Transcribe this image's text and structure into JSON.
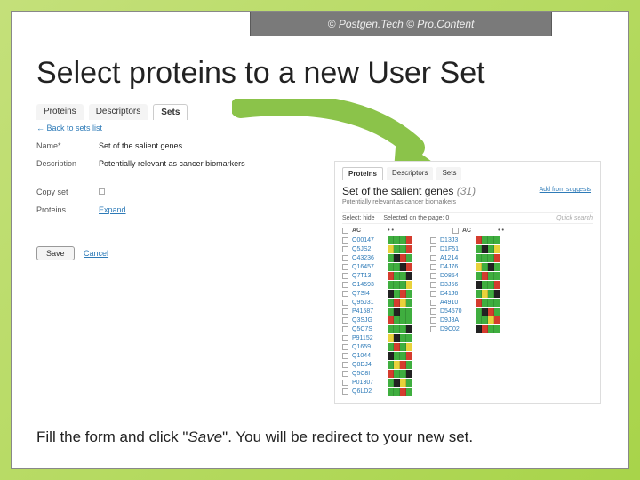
{
  "header": {
    "copyright": "© Postgen.Tech © Pro.Content"
  },
  "slide": {
    "title": "Select proteins to a new User Set"
  },
  "tabs_main": {
    "proteins": "Proteins",
    "descriptors": "Descriptors",
    "sets": "Sets"
  },
  "form": {
    "back": "← Back to sets list",
    "name_label": "Name*",
    "name_value": "Set of the salient genes",
    "desc_label": "Description",
    "desc_value": "Potentially relevant as cancer biomarkers",
    "copy_label": "Copy set",
    "proteins_label": "Proteins",
    "expand": "Expand",
    "save": "Save",
    "cancel": "Cancel"
  },
  "right": {
    "tabs": {
      "proteins": "Proteins",
      "descriptors": "Descriptors",
      "sets": "Sets"
    },
    "title": "Set of the salient genes",
    "count": "(31)",
    "subtitle": "Potentially relevant as cancer biomarkers",
    "add_link": "Add from suggests",
    "select_hide": "Select: hide",
    "selected_text": "Selected on the page: 0",
    "quick_search": "Quick search",
    "col_header": "AC",
    "col1": [
      {
        "ac": "O00147",
        "p": "gggr"
      },
      {
        "ac": "Q5JS2",
        "p": "yggr"
      },
      {
        "ac": "O43236",
        "p": "gkrg"
      },
      {
        "ac": "Q16457",
        "p": "ggkr"
      },
      {
        "ac": "Q7T13",
        "p": "rggk"
      },
      {
        "ac": "O14593",
        "p": "gggy"
      },
      {
        "ac": "Q7SI4",
        "p": "kgrg"
      },
      {
        "ac": "Q95J31",
        "p": "gryg"
      },
      {
        "ac": "P41587",
        "p": "gkgg"
      },
      {
        "ac": "Q3SJG",
        "p": "rggg"
      },
      {
        "ac": "Q5C7S",
        "p": "gggk"
      },
      {
        "ac": "P91152",
        "p": "ykgg"
      },
      {
        "ac": "Q1659",
        "p": "grgy"
      },
      {
        "ac": "Q1044",
        "p": "kggr"
      },
      {
        "ac": "Q8DJ4",
        "p": "gyrg"
      },
      {
        "ac": "Q5C8I",
        "p": "rggk"
      },
      {
        "ac": "P01307",
        "p": "gkyg"
      },
      {
        "ac": "Q6LD2",
        "p": "ggrg"
      }
    ],
    "col2": [
      {
        "ac": "D13J3",
        "p": "rggg"
      },
      {
        "ac": "D1F51",
        "p": "gkgy"
      },
      {
        "ac": "A1214",
        "p": "gggr"
      },
      {
        "ac": "D4J76",
        "p": "ygkg"
      },
      {
        "ac": "D0854",
        "p": "grgg"
      },
      {
        "ac": "D3J56",
        "p": "kggr"
      },
      {
        "ac": "D41J6",
        "p": "gygk"
      },
      {
        "ac": "A4910",
        "p": "rggg"
      },
      {
        "ac": "D54570",
        "p": "gkrg"
      },
      {
        "ac": "D9J8A",
        "p": "ggyr"
      },
      {
        "ac": "D9C02",
        "p": "krgg"
      }
    ]
  },
  "footer": {
    "pre": "Fill the form and click \"",
    "save": "Save",
    "post": "\". You will be redirect to your new set."
  }
}
